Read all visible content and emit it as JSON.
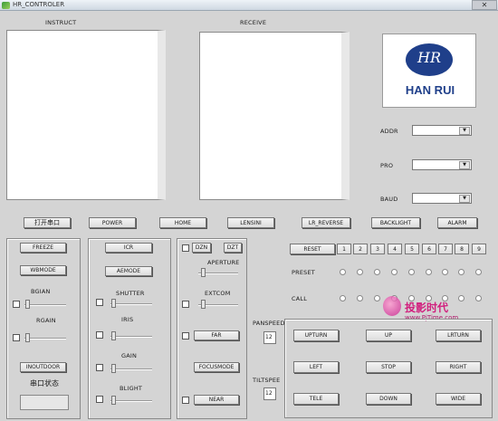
{
  "window": {
    "title": "HR_CONTROLER",
    "close_glyph": "✕"
  },
  "panels": {
    "instruct_label": "INSTRUCT",
    "receive_label": "RECEIVE"
  },
  "logo": {
    "monogram": "HR",
    "brand": "HAN RUI",
    "brand_color": "#1f3f8a"
  },
  "settings": {
    "adr_label": "ADDR",
    "pro_label": "PRO",
    "baud_label": "BAUD"
  },
  "top_buttons": [
    "打开串口",
    "POWER",
    "HOME",
    "LENSINI",
    "LR_REVERSE",
    "BACKLIGHT",
    "ALARM"
  ],
  "left_group": {
    "freeze": "FREEZE",
    "wbmode": "WBMODE",
    "bgain": "BGIAN",
    "rgain": "RGAIN",
    "inoutdoor": "INOUTDOOR",
    "serial_status": "串口状态"
  },
  "mid_group": {
    "icr": "ICR",
    "aemode": "AEMODE",
    "shutter": "SHUTTER",
    "iris": "IRIS",
    "gain": "GAIN",
    "blight": "BLIGHT"
  },
  "lens_group": {
    "dzn": "DZN",
    "dzt": "DZT",
    "aperture": "APERTURE",
    "extcom": "EXTCOM",
    "far": "FAR",
    "focusmode": "FOCUSMODE",
    "near": "NEAR"
  },
  "speeds": {
    "panspeed_label": "PANSPEED",
    "panspeed_value": "12",
    "tiltspeed_label": "TILTSPEE",
    "tiltspeed_value": "12"
  },
  "preset": {
    "reset_label": "RESET",
    "numbers": [
      "1",
      "2",
      "3",
      "4",
      "5",
      "6",
      "7",
      "8",
      "9"
    ],
    "preset_label": "PRESET",
    "call_label": "CALL"
  },
  "ptz": {
    "upturn": "UPTURN",
    "up": "UP",
    "lrturn": "LRTURN",
    "left": "LEFT",
    "stop": "STOP",
    "right": "RIGHT",
    "tele": "TELE",
    "down": "DOWN",
    "wide": "WIDE"
  },
  "watermark": {
    "text": "投影时代",
    "url": "www.PjTime.com"
  }
}
